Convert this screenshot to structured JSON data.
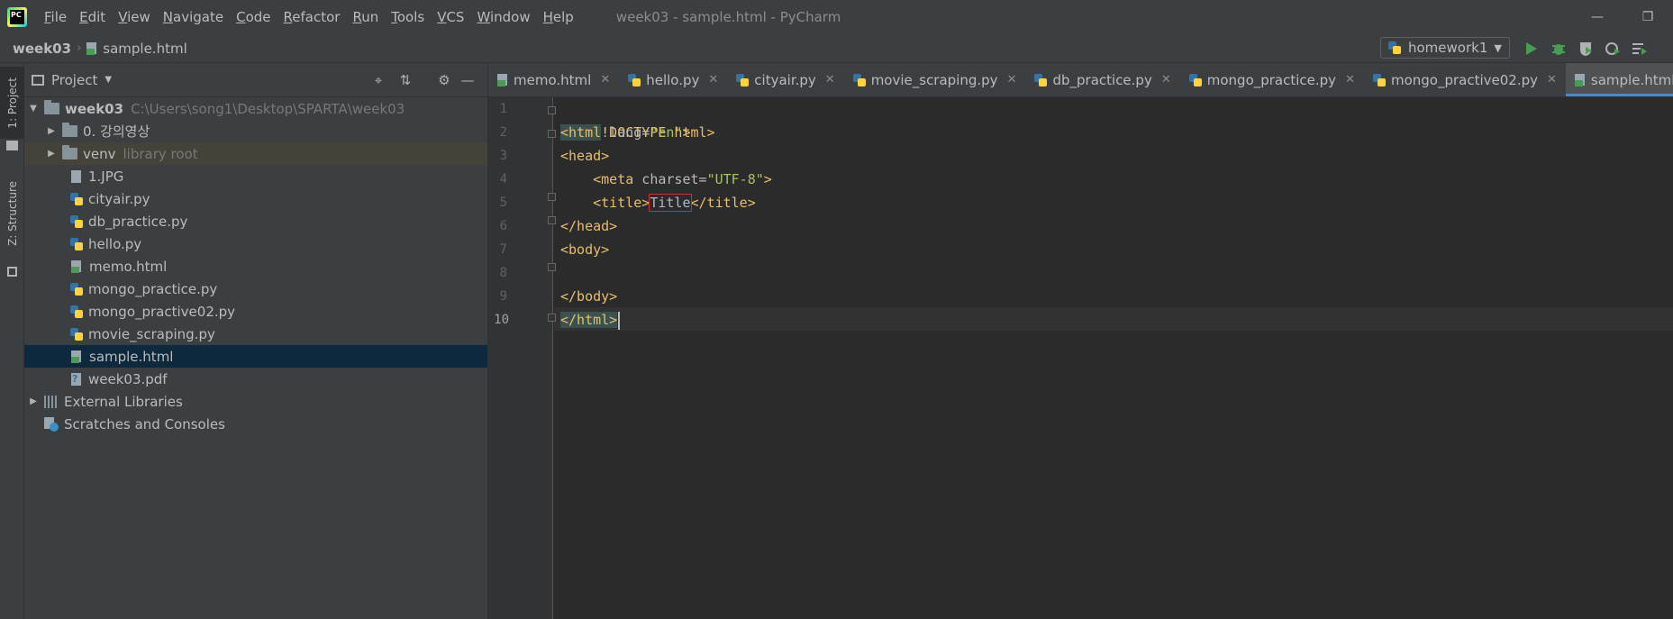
{
  "titlebar": {
    "menu": [
      {
        "first": "F",
        "rest": "ile"
      },
      {
        "first": "E",
        "rest": "dit"
      },
      {
        "first": "V",
        "rest": "iew"
      },
      {
        "first": "N",
        "rest": "avigate"
      },
      {
        "first": "C",
        "rest": "ode"
      },
      {
        "first": "R",
        "rest": "efactor"
      },
      {
        "first": "R",
        "rest": "un"
      },
      {
        "first": "T",
        "rest": "ools"
      },
      {
        "first": "V",
        "rest": "CS"
      },
      {
        "first": "W",
        "rest": "indow"
      },
      {
        "first": "H",
        "rest": "elp"
      }
    ],
    "window_title": "week03 - sample.html - PyCharm"
  },
  "navbar": {
    "project": "week03",
    "file": "sample.html",
    "run_config": "homework1"
  },
  "stripe": {
    "project_tab": "1: Project",
    "structure_tab": "Z: Structure"
  },
  "project_panel": {
    "title": "Project",
    "root": {
      "name": "week03",
      "path": "C:\\Users\\song1\\Desktop\\SPARTA\\week03"
    },
    "items": [
      {
        "name": "0. 강의영상",
        "type": "folder"
      },
      {
        "name": "venv",
        "type": "folder",
        "note": "library root"
      },
      {
        "name": "1.JPG",
        "type": "file"
      },
      {
        "name": "cityair.py",
        "type": "py"
      },
      {
        "name": "db_practice.py",
        "type": "py"
      },
      {
        "name": "hello.py",
        "type": "py"
      },
      {
        "name": "memo.html",
        "type": "html"
      },
      {
        "name": "mongo_practice.py",
        "type": "py"
      },
      {
        "name": "mongo_practive02.py",
        "type": "py"
      },
      {
        "name": "movie_scraping.py",
        "type": "py"
      },
      {
        "name": "sample.html",
        "type": "html",
        "selected": true
      },
      {
        "name": "week03.pdf",
        "type": "pdf"
      }
    ],
    "external_libraries": "External Libraries",
    "scratches": "Scratches and Consoles"
  },
  "tabs": [
    {
      "label": "memo.html",
      "type": "html"
    },
    {
      "label": "hello.py",
      "type": "py"
    },
    {
      "label": "cityair.py",
      "type": "py"
    },
    {
      "label": "movie_scraping.py",
      "type": "py"
    },
    {
      "label": "db_practice.py",
      "type": "py"
    },
    {
      "label": "mongo_practice.py",
      "type": "py"
    },
    {
      "label": "mongo_practive02.py",
      "type": "py"
    },
    {
      "label": "sample.html",
      "type": "html",
      "active": true
    }
  ],
  "editor": {
    "line_numbers": [
      "1",
      "2",
      "3",
      "4",
      "5",
      "6",
      "7",
      "8",
      "9",
      "10"
    ],
    "current_line": "10",
    "lines": {
      "l1": "<!DOCTYPE html>",
      "l2_tag": "<html",
      "l2_attr": " lang=",
      "l2_val": "\"en\"",
      "l2_end": ">",
      "l3": "<head>",
      "l4_tag": "    <meta",
      "l4_attr": " charset=",
      "l4_val": "\"UTF-8\"",
      "l4_end": ">",
      "l5_open": "    <title>",
      "l5_text": "Title",
      "l5_close": "</title>",
      "l6": "</head>",
      "l7": "<body>",
      "l8": "",
      "l9": "</body>",
      "l10": "</html>"
    }
  },
  "colors": {
    "accent": "#4a88c7",
    "tag": "#e8bf6a",
    "string": "#a5c25c",
    "selection": "#0d293e"
  }
}
